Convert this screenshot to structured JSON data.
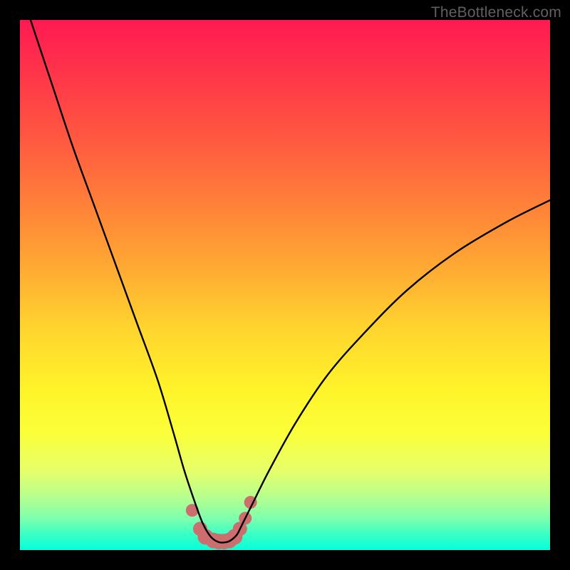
{
  "watermark": "TheBottleneck.com",
  "chart_data": {
    "type": "line",
    "title": "",
    "xlabel": "",
    "ylabel": "",
    "xlim": [
      0,
      100
    ],
    "ylim": [
      0,
      100
    ],
    "series": [
      {
        "name": "bottleneck-curve",
        "x": [
          2,
          6,
          10,
          14,
          18,
          22,
          26,
          29,
          31,
          33,
          34.5,
          36,
          37.5,
          39,
          40,
          41,
          42,
          44,
          47,
          52,
          58,
          65,
          73,
          82,
          92,
          100
        ],
        "y": [
          100,
          88,
          76,
          65,
          54,
          43,
          32,
          22,
          15,
          9,
          5,
          2.5,
          1.5,
          1.5,
          2,
          3,
          5,
          9,
          15,
          24,
          33,
          41,
          49,
          56,
          62,
          66
        ]
      }
    ],
    "markers": {
      "name": "highlight-dots",
      "x": [
        32.5,
        34,
        35,
        36.5,
        37.5,
        38.5,
        39.5,
        40.5,
        41.5,
        42.5,
        43.5
      ],
      "y": [
        7.5,
        4,
        2.5,
        1.8,
        1.6,
        1.6,
        1.8,
        2.5,
        4,
        6,
        9
      ],
      "radius": [
        9,
        10,
        11,
        11,
        11,
        11,
        11,
        11,
        10,
        9,
        9
      ]
    },
    "colors": {
      "curve": "#000000",
      "markers": "#cc6e6e"
    }
  }
}
